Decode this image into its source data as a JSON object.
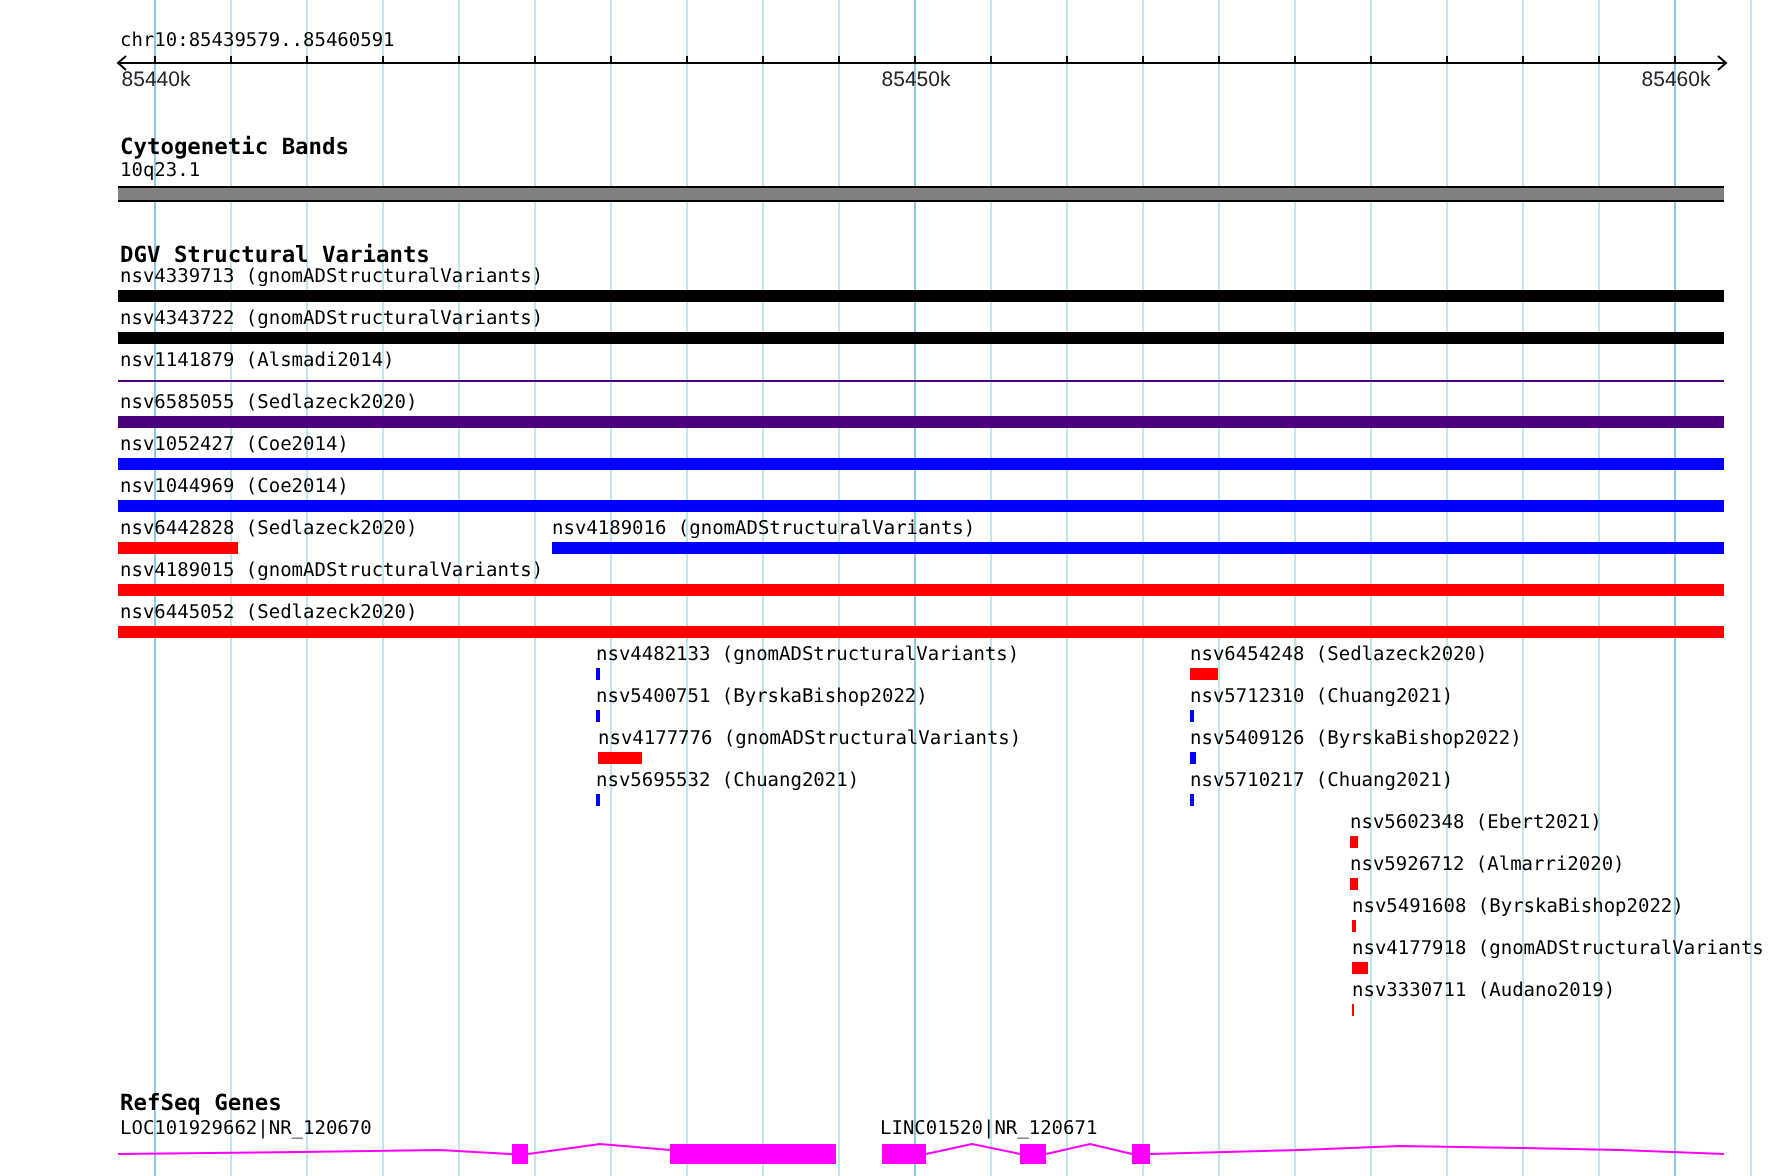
{
  "location": "chr10:85439579..85460591",
  "ruler": {
    "ticks": [
      "85440k",
      "85450k",
      "85460k"
    ]
  },
  "tracks": [
    {
      "kind": "bands",
      "title": "Cytogenetic Bands",
      "features": [
        {
          "label": "10q23.1"
        }
      ]
    },
    {
      "kind": "variants",
      "title": "DGV Structural Variants",
      "features": [
        {
          "label": "nsv4339713 (gnomADStructuralVariants)",
          "color": "#000000",
          "kind": "bar"
        },
        {
          "label": "nsv4343722 (gnomADStructuralVariants)",
          "color": "#000000",
          "kind": "bar"
        },
        {
          "label": "nsv1141879 (Alsmadi2014)",
          "color": "#4b0082",
          "kind": "line"
        },
        {
          "label": "nsv6585055 (Sedlazeck2020)",
          "color": "#4b0082",
          "kind": "bar"
        },
        {
          "label": "nsv1052427 (Coe2014)",
          "color": "#0000ff",
          "kind": "bar"
        },
        {
          "label": "nsv1044969 (Coe2014)",
          "color": "#0000ff",
          "kind": "bar"
        },
        {
          "label": "nsv6442828 (Sedlazeck2020)",
          "color": "#ff0000",
          "kind": "bar"
        },
        {
          "label": "nsv4189016 (gnomADStructuralVariants)",
          "color": "#0000ff",
          "kind": "bar"
        },
        {
          "label": "nsv4189015 (gnomADStructuralVariants)",
          "color": "#ff0000",
          "kind": "bar"
        },
        {
          "label": "nsv6445052 (Sedlazeck2020)",
          "color": "#ff0000",
          "kind": "bar"
        },
        {
          "label": "nsv4482133 (gnomADStructuralVariants)",
          "color": "#0000ff",
          "kind": "bar"
        },
        {
          "label": "nsv5400751 (ByrskaBishop2022)",
          "color": "#0000ff",
          "kind": "bar"
        },
        {
          "label": "nsv4177776 (gnomADStructuralVariants)",
          "color": "#ff0000",
          "kind": "bar"
        },
        {
          "label": "nsv5695532 (Chuang2021)",
          "color": "#0000ff",
          "kind": "bar"
        },
        {
          "label": "nsv6454248 (Sedlazeck2020)",
          "color": "#ff0000",
          "kind": "bar"
        },
        {
          "label": "nsv5712310 (Chuang2021)",
          "color": "#0000ff",
          "kind": "bar"
        },
        {
          "label": "nsv5409126 (ByrskaBishop2022)",
          "color": "#0000ff",
          "kind": "bar"
        },
        {
          "label": "nsv5710217 (Chuang2021)",
          "color": "#0000ff",
          "kind": "bar"
        },
        {
          "label": "nsv5602348 (Ebert2021)",
          "color": "#ff0000",
          "kind": "bar"
        },
        {
          "label": "nsv5926712 (Almarri2020)",
          "color": "#ff0000",
          "kind": "bar"
        },
        {
          "label": "nsv5491608 (ByrskaBishop2022)",
          "color": "#ff0000",
          "kind": "bar"
        },
        {
          "label": "nsv4177918 (gnomADStructuralVariants",
          "color": "#ff0000",
          "kind": "bar"
        },
        {
          "label": "nsv3330711 (Audano2019)",
          "color": "#ff0000",
          "kind": "bar"
        }
      ]
    },
    {
      "kind": "genes",
      "title": "RefSeq Genes",
      "features": [
        {
          "label": "LOC101929662|NR_120670"
        },
        {
          "label": "LINC01520|NR_120671"
        }
      ]
    }
  ]
}
